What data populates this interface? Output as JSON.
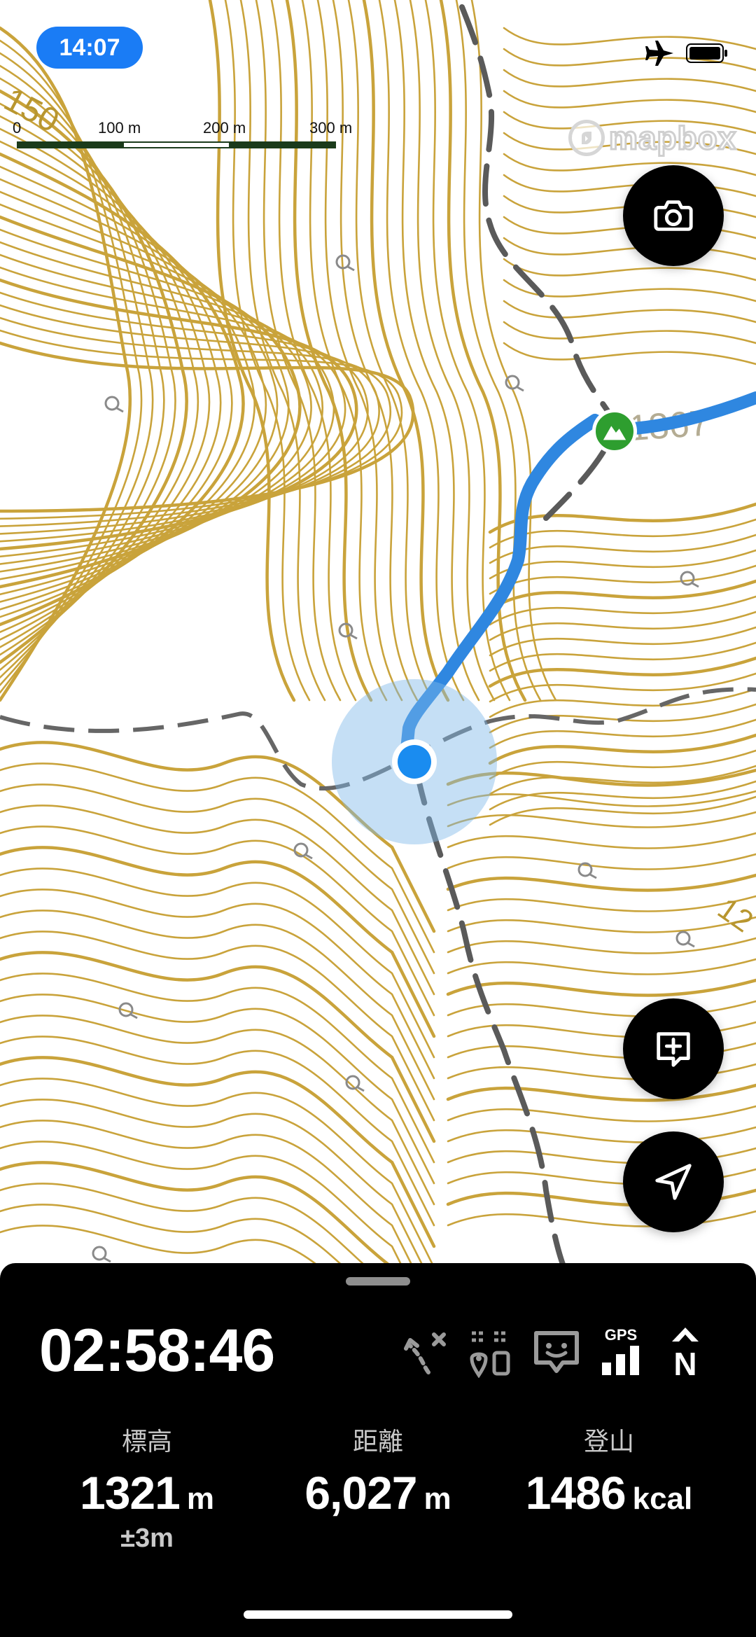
{
  "status_bar": {
    "time": "14:07",
    "airplane_icon": "airplane-icon",
    "battery_icon": "battery-icon"
  },
  "map": {
    "scale": {
      "labels": [
        "0",
        "100 m",
        "200 m",
        "300 m"
      ]
    },
    "attribution": "mapbox",
    "contour_labels": [
      "150",
      "1367",
      "12"
    ],
    "colors": {
      "contour": "#c9a33b",
      "route": "#2f87e0",
      "trail": "#5a5a5a",
      "location": "#1a8cf0",
      "peak": "#2e9e2f"
    },
    "buttons": {
      "camera_icon": "camera-icon",
      "add_note_icon": "add-note-icon",
      "locate_icon": "location-arrow-icon"
    }
  },
  "panel": {
    "elapsed_time": "02:58:46",
    "status_icons": [
      "route-off-icon",
      "waypoints-icon",
      "message-icon",
      "gps-signal-icon",
      "north-icon"
    ],
    "gps_label": "GPS",
    "north_label": "N",
    "stats": [
      {
        "label": "標高",
        "value": "1321",
        "unit": "m",
        "sub": "±3m"
      },
      {
        "label": "距離",
        "value": "6,027",
        "unit": "m"
      },
      {
        "label": "登山",
        "value": "1486",
        "unit": "kcal"
      }
    ]
  }
}
